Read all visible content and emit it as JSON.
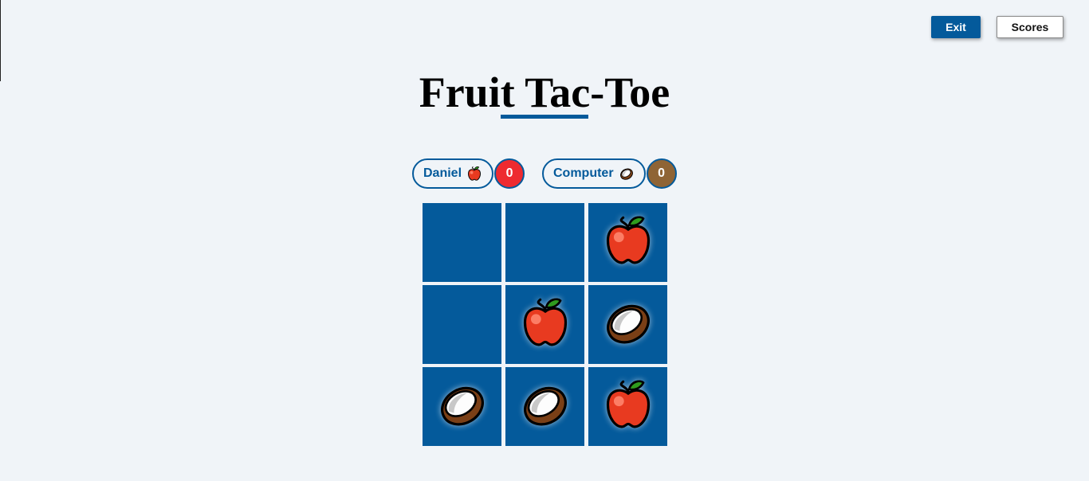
{
  "header": {
    "exit_label": "Exit",
    "scores_label": "Scores"
  },
  "title": "Fruit Tac-Toe",
  "players": [
    {
      "name": "Daniel",
      "fruit": "apple-icon",
      "score": "0",
      "score_color": "#ee2b30"
    },
    {
      "name": "Computer",
      "fruit": "coconut-icon",
      "score": "0",
      "score_color": "#8f6435"
    }
  ],
  "board": [
    [
      "",
      "",
      "apple"
    ],
    [
      "",
      "apple",
      "coconut"
    ],
    [
      "coconut",
      "coconut",
      "apple"
    ]
  ],
  "colors": {
    "accent": "#045a9b",
    "background": "#f0f4f8",
    "cell": "#045a9b"
  }
}
